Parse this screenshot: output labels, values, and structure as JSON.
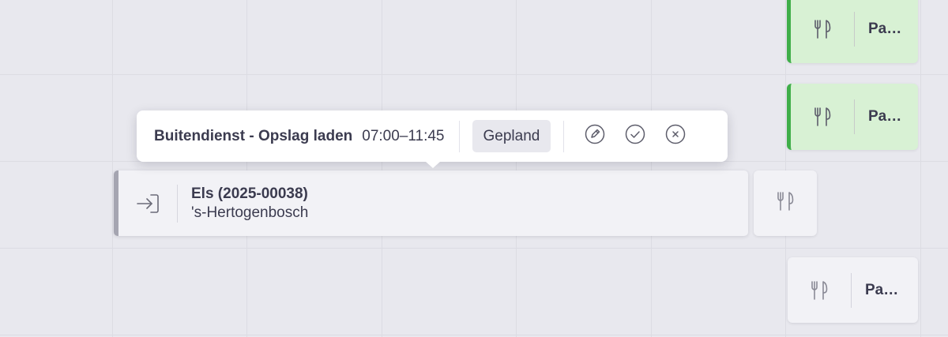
{
  "popover": {
    "title": "Buitendienst - Opslag laden",
    "time": "07:00–11:45",
    "status": "Gepland"
  },
  "shift": {
    "name": "Els (2025-00038)",
    "location": "'s-Hertogenbosch"
  },
  "cards": [
    {
      "label": "Pa…",
      "state": "green"
    },
    {
      "label": "Pa…",
      "state": "green"
    },
    {
      "label": "Pa…",
      "state": "plain"
    }
  ],
  "icons": {
    "meal": "fork-knife-icon",
    "login": "login-icon",
    "edit": "pencil-icon",
    "confirm": "check-circle-icon",
    "cancel": "x-circle-icon"
  },
  "colors": {
    "accent_green": "#3fae49",
    "card_green": "#d8f1d4",
    "shift_border": "#a5a5b1",
    "background": "#e8e8ee"
  }
}
